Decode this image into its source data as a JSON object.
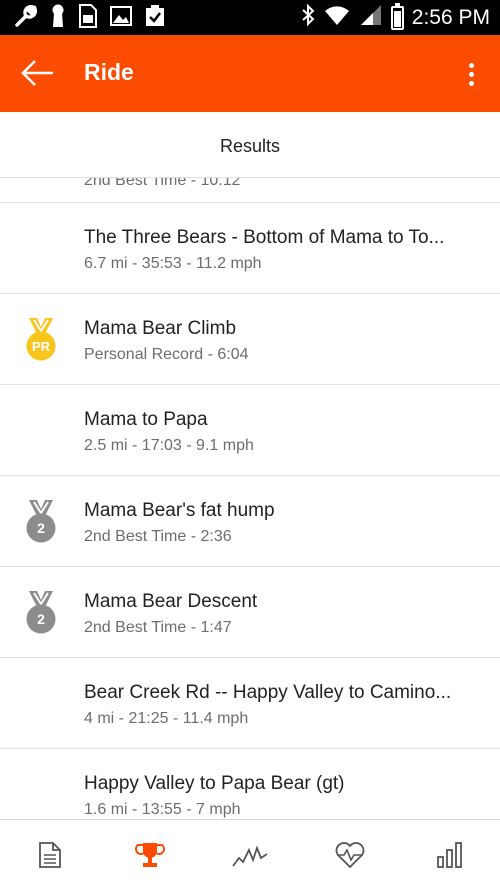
{
  "status_bar": {
    "time": "2:56 PM",
    "left_icons": [
      "wrench-icon",
      "keyhole-icon",
      "sd-card-icon",
      "image-icon",
      "clipboard-check-icon"
    ],
    "right_icons": [
      "bluetooth-icon",
      "wifi-icon",
      "cell-signal-icon",
      "battery-icon"
    ]
  },
  "app_bar": {
    "title": "Ride",
    "background": "#fc4c02",
    "back_icon": "arrow-back-icon",
    "overflow_icon": "more-vert-icon"
  },
  "section": {
    "title": "Results",
    "partial_row_subtitle": "2nd Best Time - 10:12"
  },
  "results": [
    {
      "name": "The Three Bears - Bottom of Mama to To...",
      "subtitle": "6.7 mi - 35:53 - 11.2 mph",
      "medal": "none"
    },
    {
      "name": "Mama Bear Climb",
      "subtitle": "Personal Record - 6:04",
      "medal": "pr",
      "medal_label": "PR"
    },
    {
      "name": "Mama to Papa",
      "subtitle": "2.5 mi - 17:03 - 9.1 mph",
      "medal": "none"
    },
    {
      "name": "Mama Bear's fat hump",
      "subtitle": "2nd Best Time - 2:36",
      "medal": "silver",
      "medal_label": "2"
    },
    {
      "name": "Mama Bear Descent",
      "subtitle": "2nd Best Time - 1:47",
      "medal": "silver",
      "medal_label": "2"
    },
    {
      "name": "Bear Creek Rd -- Happy Valley to Camino...",
      "subtitle": "4 mi - 21:25 - 11.4 mph",
      "medal": "none"
    },
    {
      "name": "Happy Valley to Papa Bear (gt)",
      "subtitle": "1.6 mi - 13:55 - 7 mph",
      "medal": "none"
    }
  ],
  "colors": {
    "accent": "#fc4c02",
    "pr_gold": "#f8c51c",
    "silver": "#8c8c8c"
  },
  "bottom_nav": [
    {
      "icon": "document-icon",
      "active": false
    },
    {
      "icon": "trophy-icon",
      "active": true
    },
    {
      "icon": "elevation-chart-icon",
      "active": false
    },
    {
      "icon": "heart-rate-icon",
      "active": false
    },
    {
      "icon": "bar-chart-icon",
      "active": false
    }
  ]
}
